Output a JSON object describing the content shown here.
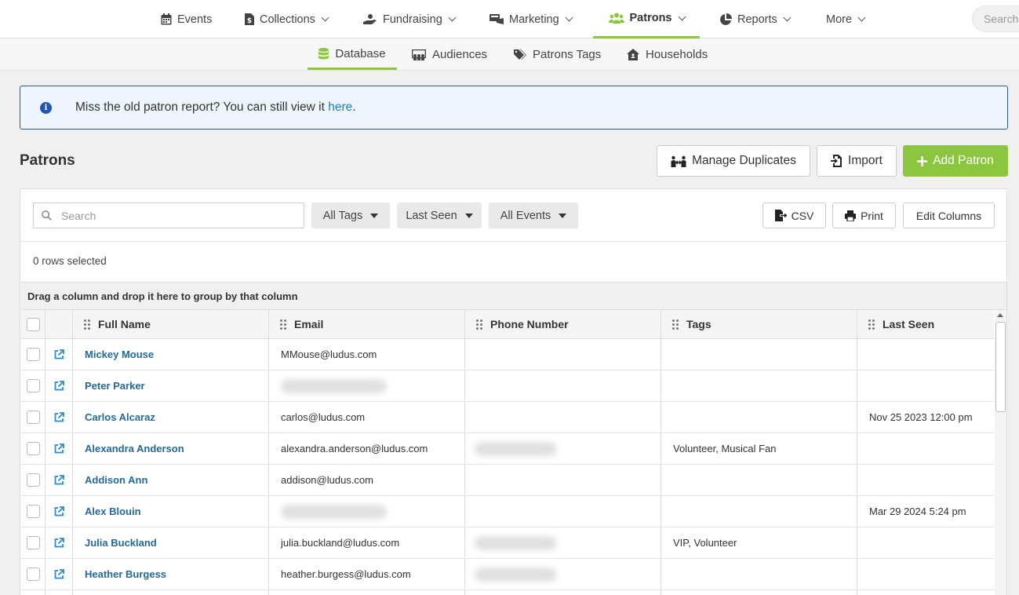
{
  "top_nav": {
    "items": [
      {
        "label": "Events",
        "icon": "calendar-icon"
      },
      {
        "label": "Collections",
        "icon": "dollar-doc-icon"
      },
      {
        "label": "Fundraising",
        "icon": "hand-donate-icon"
      },
      {
        "label": "Marketing",
        "icon": "megaphone-icon"
      },
      {
        "label": "Patrons",
        "icon": "users-icon",
        "active": true
      },
      {
        "label": "Reports",
        "icon": "pie-chart-icon"
      },
      {
        "label": "More"
      }
    ],
    "search_placeholder": "Search"
  },
  "sub_nav": {
    "items": [
      {
        "label": "Database",
        "icon": "database-icon",
        "active": true
      },
      {
        "label": "Audiences",
        "icon": "audience-icon"
      },
      {
        "label": "Patrons Tags",
        "icon": "tags-icon"
      },
      {
        "label": "Households",
        "icon": "house-icon"
      }
    ]
  },
  "alert": {
    "text": "Miss the old patron report? You can still view it ",
    "link": "here",
    "suffix": "."
  },
  "page": {
    "title": "Patrons",
    "manage_duplicates": "Manage Duplicates",
    "import": "Import",
    "add_patron": "Add Patron"
  },
  "toolbar": {
    "search_placeholder": "Search",
    "all_tags": "All Tags",
    "last_seen": "Last Seen",
    "all_events": "All Events",
    "csv": "CSV",
    "print": "Print",
    "edit_columns": "Edit Columns",
    "rows_selected": "0 rows selected"
  },
  "grid": {
    "group_hint": "Drag a column and drop it here to group by that column",
    "columns": [
      "Full Name",
      "Email",
      "Phone Number",
      "Tags",
      "Last Seen"
    ],
    "rows": [
      {
        "name": "Mickey Mouse",
        "email": "MMouse@ludus.com",
        "email_hidden": false,
        "phone_hidden": false,
        "tags": "",
        "last_seen": ""
      },
      {
        "name": "Peter Parker",
        "email": "",
        "email_hidden": true,
        "phone_hidden": false,
        "tags": "",
        "last_seen": ""
      },
      {
        "name": "Carlos Alcaraz",
        "email": "carlos@ludus.com",
        "email_hidden": false,
        "phone_hidden": false,
        "tags": "",
        "last_seen": "Nov 25 2023 12:00 pm"
      },
      {
        "name": "Alexandra Anderson",
        "email": "alexandra.anderson@ludus.com",
        "email_hidden": false,
        "phone_hidden": true,
        "tags": "Volunteer, Musical Fan",
        "last_seen": ""
      },
      {
        "name": "Addison Ann",
        "email": "addison@ludus.com",
        "email_hidden": false,
        "phone_hidden": false,
        "tags": "",
        "last_seen": ""
      },
      {
        "name": "Alex Blouin",
        "email": "",
        "email_hidden": true,
        "phone_hidden": false,
        "tags": "",
        "last_seen": "Mar 29 2024 5:24 pm"
      },
      {
        "name": "Julia Buckland",
        "email": "julia.buckland@ludus.com",
        "email_hidden": false,
        "phone_hidden": true,
        "tags": "VIP, Volunteer",
        "last_seen": ""
      },
      {
        "name": "Heather Burgess",
        "email": "heather.burgess@ludus.com",
        "email_hidden": false,
        "phone_hidden": true,
        "tags": "",
        "last_seen": ""
      },
      {
        "name": "",
        "email": "",
        "email_hidden": false,
        "phone_hidden": false,
        "tags": "",
        "last_seen": ""
      }
    ]
  },
  "colors": {
    "accent": "#8cc63f",
    "link": "#226a9c",
    "info": "#1f55b8"
  }
}
